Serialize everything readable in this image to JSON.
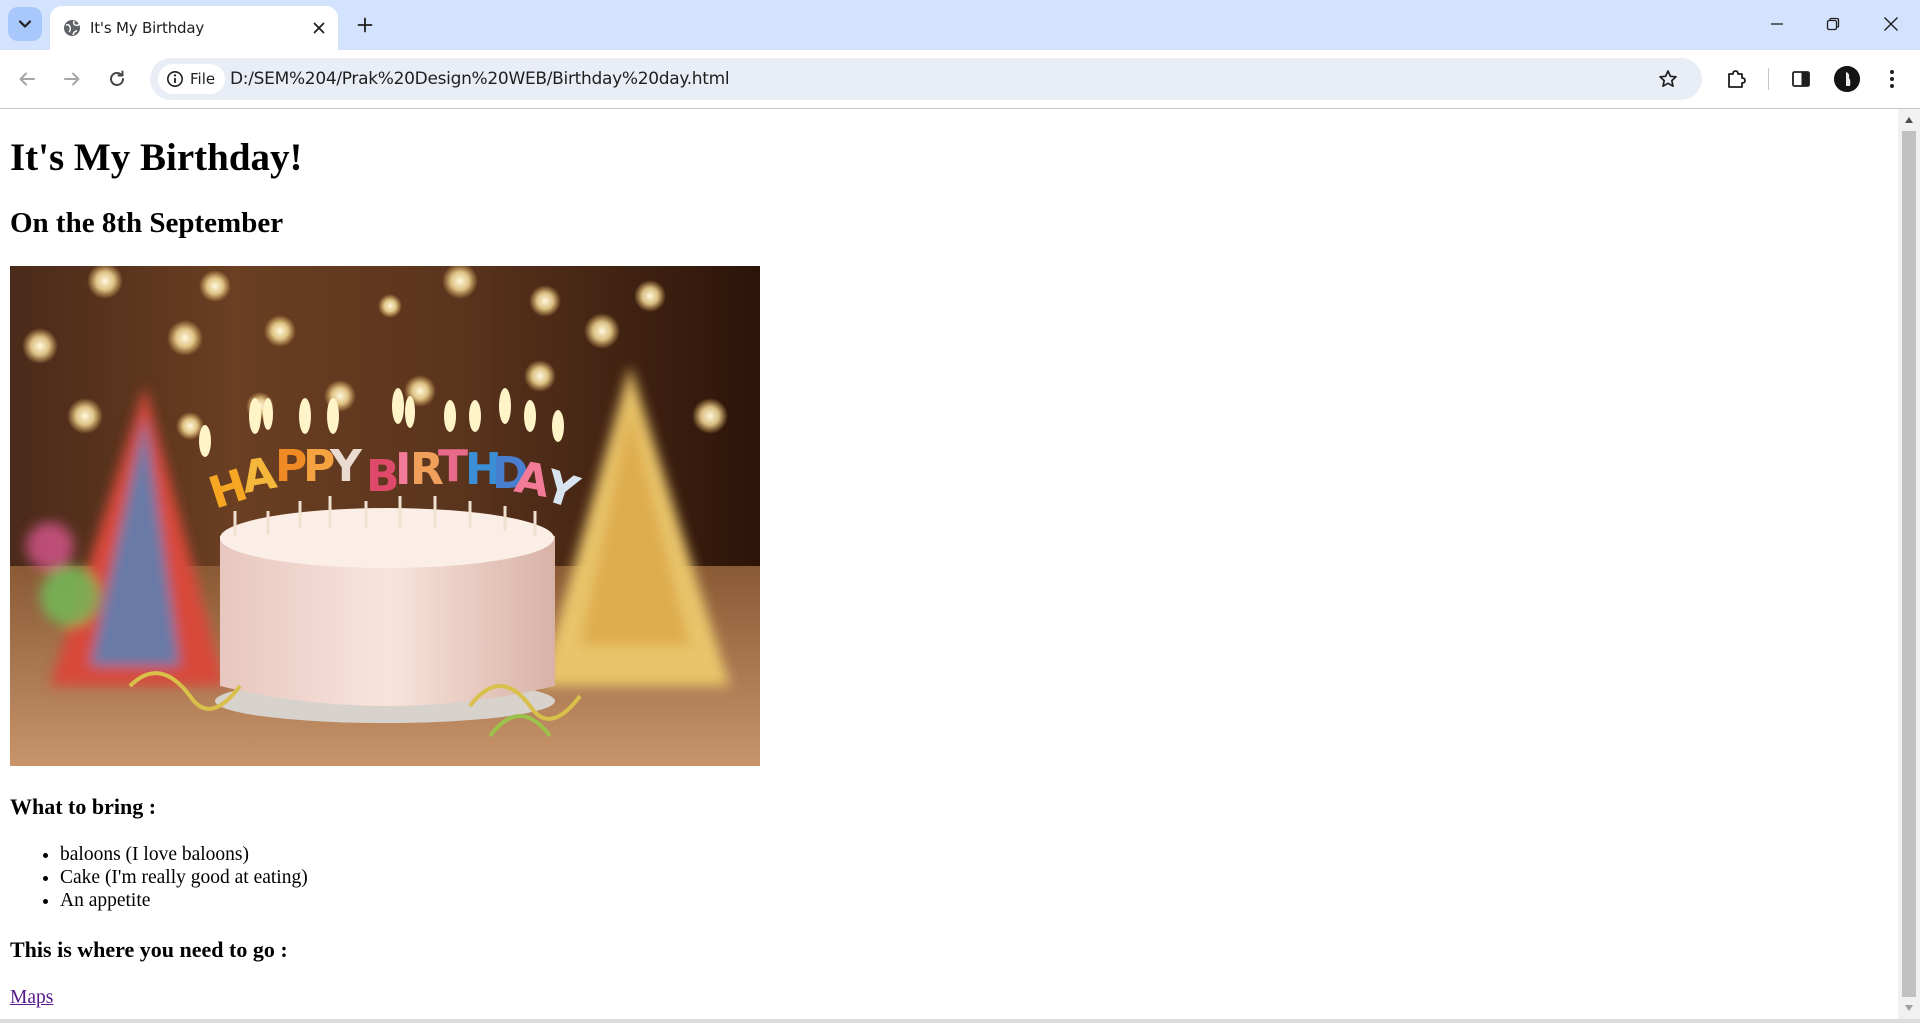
{
  "browser": {
    "tab": {
      "title": "It's My Birthday"
    },
    "address": {
      "chip_label": "File",
      "url": "D:/SEM%204/Prak%20Design%20WEB/Birthday%20day.html"
    },
    "accent": "#d3e3fd"
  },
  "page": {
    "title": "It's My Birthday!",
    "subtitle": "On the 8th September",
    "image_description_icon": "birthday-cake-photo",
    "cake_letters": [
      "H",
      "A",
      "P",
      "P",
      "Y",
      "B",
      "I",
      "R",
      "T",
      "H",
      "D",
      "A",
      "Y"
    ],
    "bring_heading": "What to bring :",
    "bring_items": [
      "baloons (I love baloons)",
      "Cake (I'm really good at eating)",
      "An appetite"
    ],
    "go_heading": "This is where you need to go :",
    "maps_link": "Maps"
  }
}
